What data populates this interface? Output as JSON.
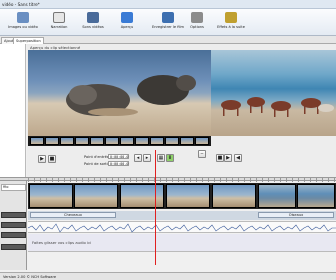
{
  "window": {
    "title": "vidéo - Sans titre*"
  },
  "toolbar": {
    "items": [
      {
        "label": "Images ou vidéo",
        "icon": "add-media-icon"
      },
      {
        "label": "Narration",
        "icon": "speech-bubble-icon"
      },
      {
        "label": "Sons vidéos",
        "icon": "film-icon"
      },
      {
        "label": "Aperçu",
        "icon": "preview-icon"
      },
      {
        "label": "Enregistrer le film",
        "icon": "save-film-icon"
      },
      {
        "label": "Options",
        "icon": "options-icon"
      },
      {
        "label": "Effets à la suite",
        "icon": "effects-icon"
      }
    ]
  },
  "tabs": [
    "Ajouter",
    "Superposition"
  ],
  "preview": {
    "label": "Aperçu du clip sélectionné"
  },
  "controls": {
    "start_label": "Point d'entrée",
    "start_value": "0:00:00.0",
    "end_label": "Point de sortie",
    "end_value": "0:00:00.0"
  },
  "timeline": {
    "track_labels": [
      "ffto",
      "",
      ""
    ],
    "transitions": [
      "Cheveaux",
      "Oiseaux"
    ],
    "audio_placeholder": "Faites glisser vos clips audio ici"
  },
  "status": {
    "text": "Version 2.00 © NCH Software"
  },
  "colors": {
    "accent": "#3a7bd5",
    "cursor": "#e02020"
  }
}
